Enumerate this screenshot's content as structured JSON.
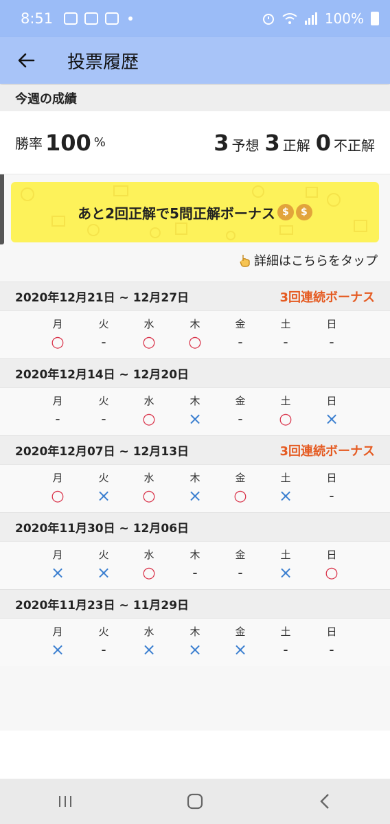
{
  "status_bar": {
    "time": "8:51",
    "battery": "100%"
  },
  "app_bar": {
    "title": "投票履歴"
  },
  "this_week": {
    "section_label": "今週の成績",
    "win_rate_label": "勝率",
    "win_rate_value": "100",
    "win_rate_unit": "%",
    "predictions_value": "3",
    "predictions_label": "予想",
    "correct_value": "3",
    "correct_label": "正解",
    "incorrect_value": "0",
    "incorrect_label": "不正解"
  },
  "banner": {
    "text": "あと2回正解で5問正解ボーナス"
  },
  "detail_link": {
    "text": "詳細はこちらをタップ"
  },
  "day_names": [
    "月",
    "火",
    "水",
    "木",
    "金",
    "土",
    "日"
  ],
  "weeks": [
    {
      "range": "2020年12月21日 ~ 12月27日",
      "bonus": "3回連続ボーナス",
      "results": [
        "○",
        "-",
        "○",
        "○",
        "-",
        "-",
        "-"
      ]
    },
    {
      "range": "2020年12月14日 ~ 12月20日",
      "bonus": "",
      "results": [
        "-",
        "-",
        "○",
        "×",
        "-",
        "○",
        "×"
      ]
    },
    {
      "range": "2020年12月07日 ~ 12月13日",
      "bonus": "3回連続ボーナス",
      "results": [
        "○",
        "×",
        "○",
        "×",
        "○",
        "×",
        "-"
      ]
    },
    {
      "range": "2020年11月30日 ~ 12月06日",
      "bonus": "",
      "results": [
        "×",
        "×",
        "○",
        "-",
        "-",
        "×",
        "○"
      ]
    },
    {
      "range": "2020年11月23日 ~ 11月29日",
      "bonus": "",
      "results": [
        "×",
        "-",
        "×",
        "×",
        "×",
        "-",
        "-"
      ]
    }
  ],
  "colors": {
    "correct": "#d9334a",
    "incorrect": "#3b7fd0",
    "bonus": "#e55b22",
    "appbar": "#a8c4f8",
    "banner": "#fdf25a"
  }
}
